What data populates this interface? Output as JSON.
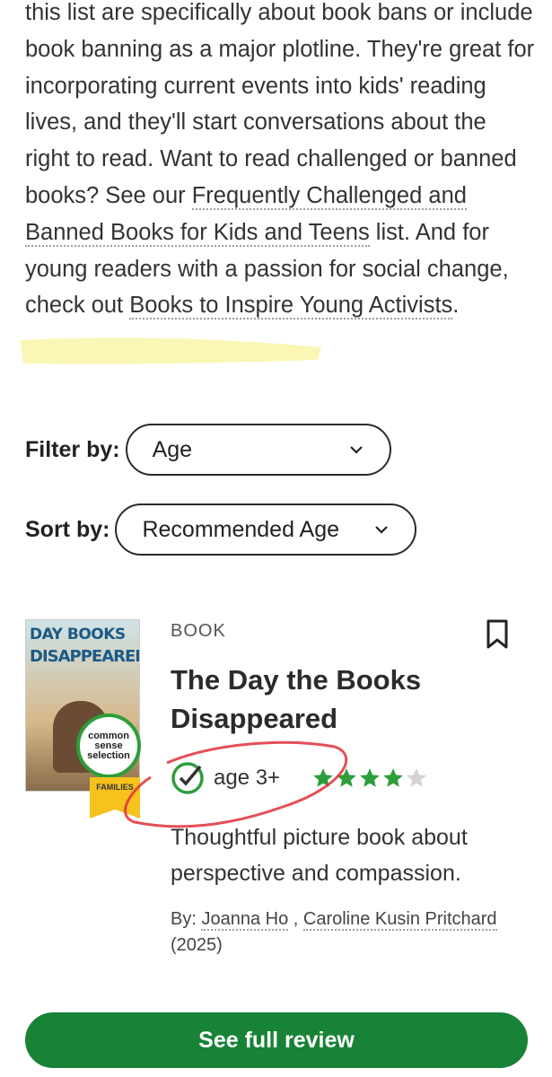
{
  "intro": {
    "line_text": "this list are specifically about book bans or include book banning as a major plotline. They're great for incorporating current events into kids' reading lives, and they'll start conversations about the right to read. Want to read challenged or banned books? See our ",
    "link1": "Frequently Challenged and Banned Books for Kids and Teens",
    "mid_text": " list. And for young readers with a passion for social change, check out ",
    "link2": "Books to Inspire Young Activists",
    "end_text": "."
  },
  "filter": {
    "label": "Filter by:",
    "value": "Age"
  },
  "sort": {
    "label": "Sort by:",
    "value": "Recommended Age"
  },
  "card": {
    "type": "BOOK",
    "title": "The Day the Books Disappeared",
    "age": "age 3+",
    "rating": 4,
    "rating_max": 5,
    "summary": "Thoughtful picture book about perspective and compassion.",
    "by_label": "By: ",
    "authors": [
      "Joanna Ho",
      "Caroline Kusin Pritchard"
    ],
    "year": "(2025)",
    "cover": {
      "line1": "DAY BOOKS",
      "line2": "DISAPPEARED",
      "badge": "common sense selection",
      "ribbon": "FAMILIES"
    }
  },
  "cta": {
    "label": "See full review"
  },
  "colors": {
    "accent": "#188236",
    "star": "#2e9e3a",
    "highlight": "#f5f07a",
    "annotation": "#e0303a"
  }
}
